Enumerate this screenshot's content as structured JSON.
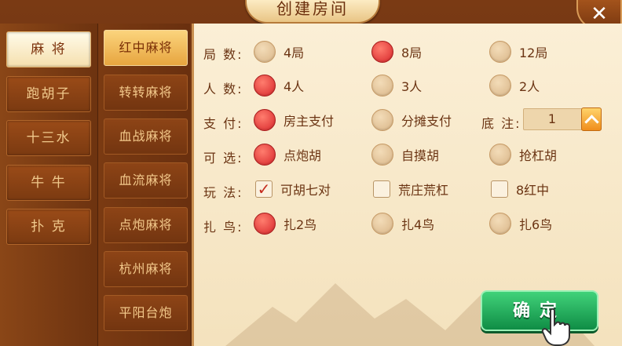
{
  "dialog": {
    "title": "创建房间",
    "close_label": "✕"
  },
  "categories": [
    {
      "label": "麻 将",
      "active": true
    },
    {
      "label": "跑胡子",
      "active": false
    },
    {
      "label": "十三水",
      "active": false
    },
    {
      "label": "牛 牛",
      "active": false
    },
    {
      "label": "扑 克",
      "active": false
    }
  ],
  "sub_categories": [
    {
      "label": "红中麻将",
      "active": true
    },
    {
      "label": "转转麻将",
      "active": false
    },
    {
      "label": "血战麻将",
      "active": false
    },
    {
      "label": "血流麻将",
      "active": false
    },
    {
      "label": "点炮麻将",
      "active": false
    },
    {
      "label": "杭州麻将",
      "active": false
    },
    {
      "label": "平阳台炮",
      "active": false
    }
  ],
  "settings": {
    "rounds": {
      "label": "局  数:",
      "options": [
        {
          "text": "4局",
          "selected": false
        },
        {
          "text": "8局",
          "selected": true
        },
        {
          "text": "12局",
          "selected": false
        }
      ]
    },
    "players": {
      "label": "人  数:",
      "options": [
        {
          "text": "4人",
          "selected": true
        },
        {
          "text": "3人",
          "selected": false
        },
        {
          "text": "2人",
          "selected": false
        }
      ]
    },
    "payment": {
      "label": "支  付:",
      "options": [
        {
          "text": "房主支付",
          "selected": true
        },
        {
          "text": "分摊支付",
          "selected": false
        }
      ]
    },
    "base_bet": {
      "label": "底  注:",
      "value": "1"
    },
    "optional": {
      "label": "可  选:",
      "options": [
        {
          "text": "点炮胡",
          "selected": true
        },
        {
          "text": "自摸胡",
          "selected": false
        },
        {
          "text": "抢杠胡",
          "selected": false
        }
      ]
    },
    "rules": {
      "label": "玩  法:",
      "options": [
        {
          "text": "可胡七对",
          "checked": true
        },
        {
          "text": "荒庄荒杠",
          "checked": false
        },
        {
          "text": "8红中",
          "checked": false
        }
      ]
    },
    "birds": {
      "label": "扎  鸟:",
      "options": [
        {
          "text": "扎2鸟",
          "selected": true
        },
        {
          "text": "扎4鸟",
          "selected": false
        },
        {
          "text": "扎6鸟",
          "selected": false
        }
      ]
    }
  },
  "confirm_label": "确定",
  "checkmark_glyph": "✓"
}
